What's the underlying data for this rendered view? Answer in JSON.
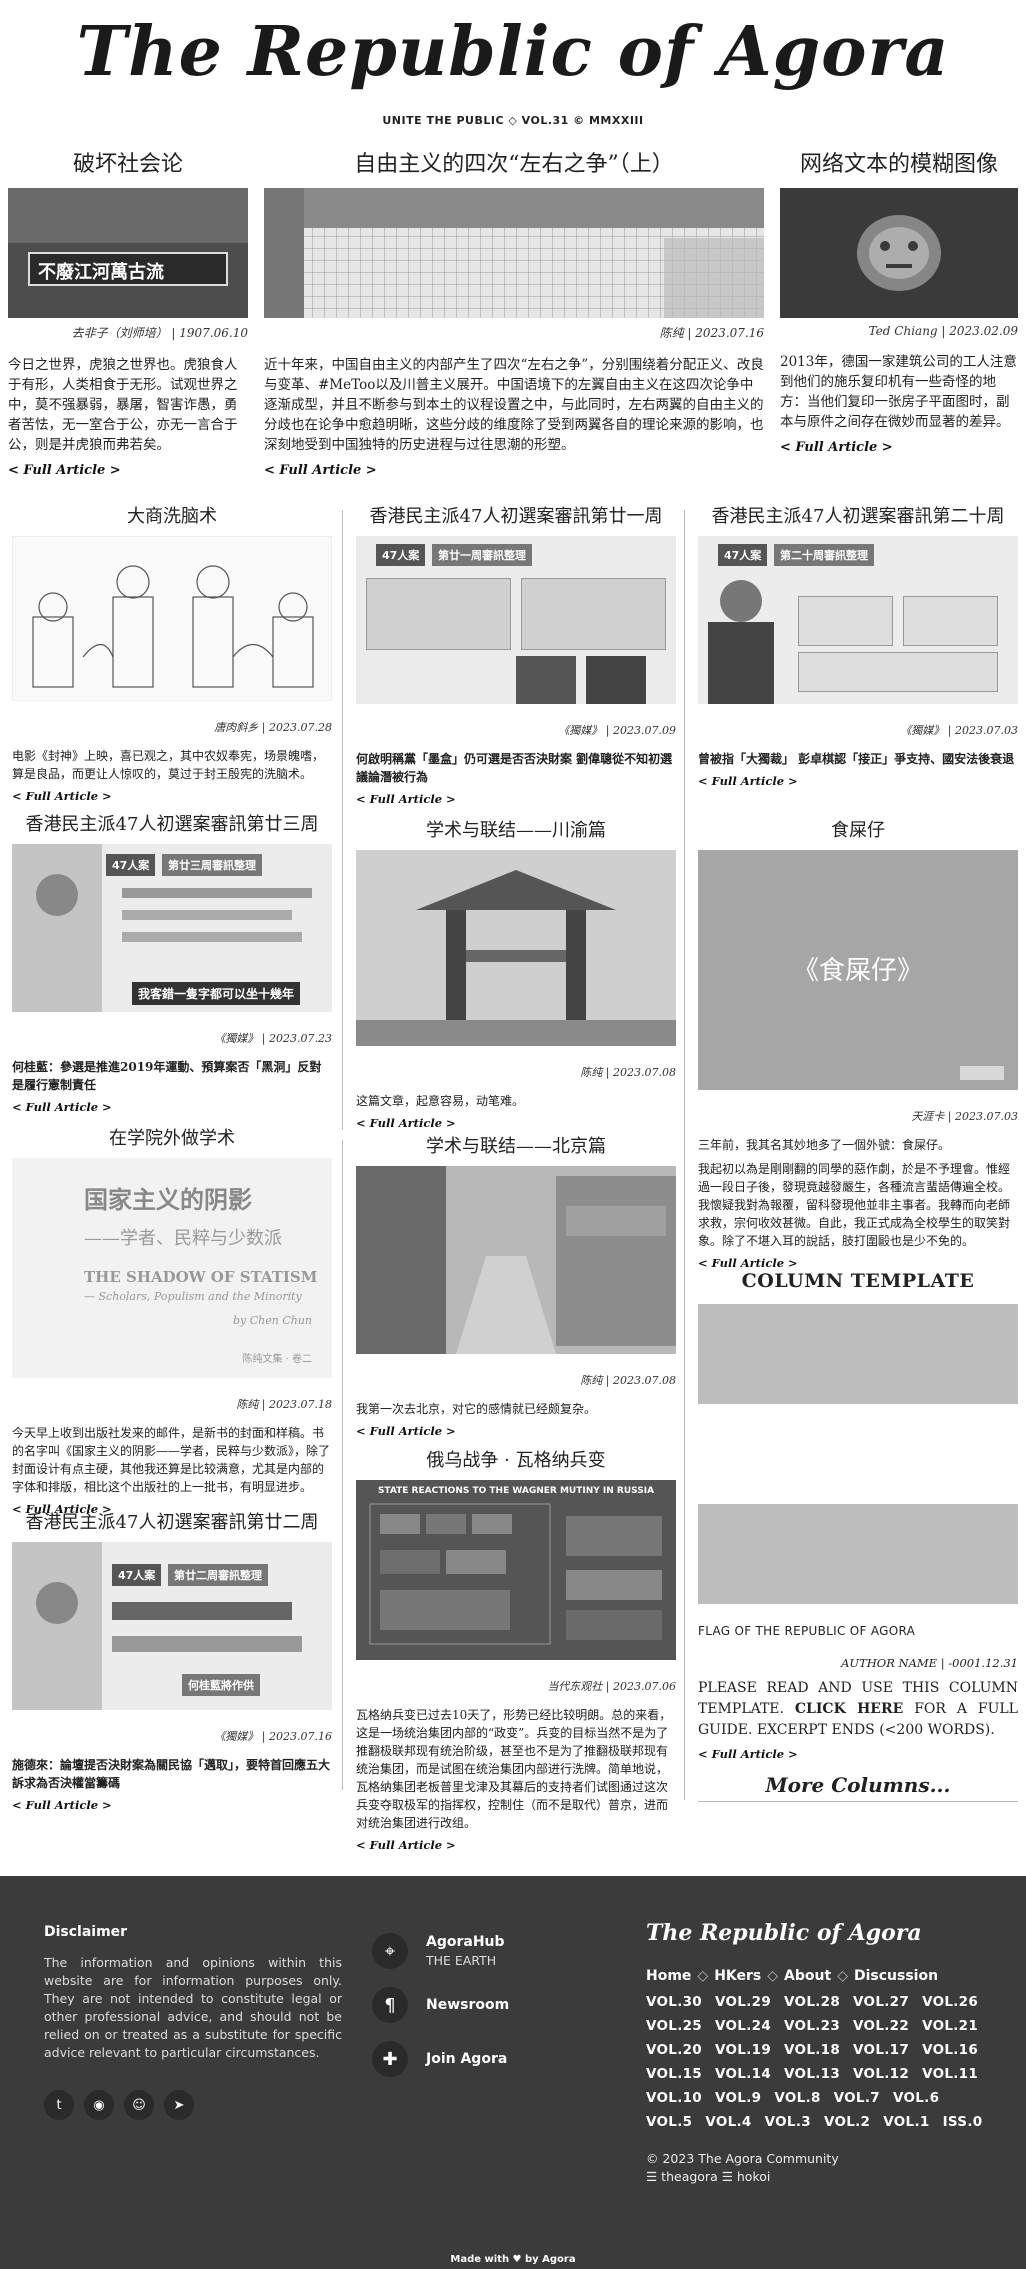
{
  "masthead": {
    "title": "The Republic of Agora",
    "tagline": "UNITE THE PUBLIC ◇ VOL.31 © MMXXIII"
  },
  "top": [
    {
      "title": "破坏社会论",
      "caption": "去非子（刘师培） | 1907.06.10",
      "image_text": "不廢江河萬古流",
      "excerpt": "今日之世界，虎狼之世界也。虎狼食人于有形，人类相食于无形。试观世界之中，莫不强暴弱，暴屠，智害诈愚，勇者苦怯，无一室合于公，亦无一言合于公，则是并虎狼而弗若矣。",
      "link": "< Full Article >"
    },
    {
      "title": "自由主义的四次“左右之争”（上）",
      "caption": "陈纯 | 2023.07.16",
      "excerpt": "近十年来，中国自由主义的内部产生了四次“左右之争”，分别围绕着分配正义、改良与变革、#MeToo以及川普主义展开。中国语境下的左翼自由主义在这四次论争中逐渐成型，并且不断参与到本土的议程设置之中，与此同时，左右两翼的自由主义的分歧也在论争中愈趋明晰，这些分歧的维度除了受到两翼各自的理论来源的影响，也深刻地受到中国独特的历史进程与过往思潮的形塑。",
      "link": "< Full Article >"
    },
    {
      "title": "网络文本的模糊图像",
      "caption": "Ted Chiang | 2023.02.09",
      "excerpt": "2013年，德国一家建筑公司的工人注意到他们的施乐复印机有一些奇怪的地方：当他们复印一张房子平面图时，副本与原件之间存在微妙而显著的差异。",
      "link": "< Full Article >"
    }
  ],
  "col1": [
    {
      "title": "大商洗脑术",
      "caption": "唐肉斜乡 | 2023.07.28",
      "excerpt": "电影《封神》上映，喜已观之，其中农奴奉宪，场景魄嗜，算是良品，而更让人惊叹的，莫过于封王殷宪的洗脑术。",
      "link": "< Full Article >"
    },
    {
      "title": "香港民主派47人初選案審訊第廿三周",
      "caption": "《獨媒》 | 2023.07.23",
      "image_tag": "47人案",
      "image_sub": "第廿三周審訊整理",
      "image_quote": "我客錯一隻字都可以坐十幾年",
      "excerpt": "何桂藍：參選是推進2019年運動、預算案否「黑洞」反對是履行憲制責任",
      "link": "< Full Article >"
    },
    {
      "title": "在学院外做学术",
      "caption": "陈纯 | 2023.07.18",
      "book_title": "国家主义的阴影",
      "book_sub": "——学者、民粹与少数派",
      "book_en": "THE SHADOW OF STATISM",
      "book_en_sub": "— Scholars, Populism and the Minority",
      "book_author": "by Chen Chun",
      "book_series": "陈纯文集 · 卷二",
      "excerpt": "今天早上收到出版社发来的邮件，是新书的封面和样稿。书的名字叫《国家主义的阴影——学者，民粹与少数派》，除了封面设计有点主硬，其他我还算是比较满意，尤其是内部的字体和排版，相比这个出版社的上一批书，有明显进步。",
      "link": "< Full Article >"
    },
    {
      "title": "香港民主派47人初選案審訊第廿二周",
      "caption": "《獨媒》 | 2023.07.16",
      "image_tag": "47人案",
      "image_sub": "第廿二周審訊整理",
      "image_quote": "何桂藍將作供",
      "excerpt": "施德來：論壇提否決財案為關民協「邁取」，要特首回應五大訴求為否決權當籌碼",
      "link": "< Full Article >"
    }
  ],
  "col2": [
    {
      "title": "香港民主派47人初選案審訊第廿一周",
      "caption": "《獨媒》 | 2023.07.09",
      "image_tag": "47人案",
      "image_sub": "第廿一周審訊整理",
      "excerpt": "何啟明稱黨「墨盒」仍可選是否否決財案 劉偉聰從不知初選議論潛被行為",
      "link": "< Full Article >"
    },
    {
      "title": "学术与联结——川渝篇",
      "caption": "陈纯 | 2023.07.08",
      "excerpt": "这篇文章，起意容易，动笔难。",
      "link": "< Full Article >"
    },
    {
      "title": "学术与联结——北京篇",
      "caption": "陈纯 | 2023.07.08",
      "excerpt": "我第一次去北京，对它的感情就已经颇复杂。",
      "link": "< Full Article >"
    },
    {
      "title": "俄乌战争 · 瓦格纳兵变",
      "caption": "当代东观社 | 2023.07.06",
      "chart_heading": "STATE REACTIONS TO THE WAGNER MUTINY IN RUSSIA",
      "excerpt": "瓦格纳兵变已过去10天了，形势已经比较明朗。总的来看，这是一场统治集团内部的“政变”。兵变的目标当然不是为了推翻极联邦现有统治阶级，甚至也不是为了推翻极联邦现有统治集团，而是试图在统治集团内部进行洗牌。简单地说，瓦格纳集团老板普里戈津及其幕后的支持者们试图通过这次兵变夺取极军的指挥权，控制住（而不是取代）普京，进而对统治集团进行改组。",
      "link": "< Full Article >"
    }
  ],
  "col3": [
    {
      "title": "香港民主派47人初選案審訊第二十周",
      "caption": "《獨媒》 | 2023.07.03",
      "image_tag": "47人案",
      "image_sub": "第二十周審訊整理",
      "excerpt": "曾被指「大獨裁」 彭卓棋認「接正」爭支持、國安法後衰退",
      "link": "< Full Article >"
    },
    {
      "title": "食屎仔",
      "caption": "天涯卡 | 2023.07.03",
      "image_text": "《食屎仔》",
      "excerpt1": "三年前，我其名其妙地多了一個外號：食屎仔。",
      "excerpt2": "我起初以為是剛剛翻的同學的惡作劇，於是不予理會。惟經過一段日子後，發現竟越發嚴生，各種流言蜚語傳遍全校。我懷疑我對為報覆，留科發現他並非主事者。我轉而向老師求救，宗何收效甚微。自此，我正式成為全校學生的取笑對象。除了不堪入耳的說話，肢打圍毆也是少不免的。",
      "link": "< Full Article >"
    },
    {
      "template_title": "COLUMN TEMPLATE",
      "flag_caption": "FLAG OF THE REPUBLIC OF AGORA",
      "author": "AUTHOR NAME | -0001.12.31",
      "body_before": "PLEASE READ AND USE THIS COLUMN TEMPLATE.",
      "body_link": "CLICK HERE",
      "body_after": "FOR A FULL GUIDE. EXCERPT ENDS (<200 WORDS).",
      "link": "< Full Article >"
    }
  ],
  "more_columns": "More Columns...",
  "footer": {
    "disclaimer_title": "Disclaimer",
    "disclaimer_text": "The information and opinions within this website are for information purposes only. They are not intended to constitute legal or other professional advice, and should not be relied on or treated as a substitute for specific advice relevant to particular circumstances.",
    "links": [
      {
        "title": "AgoraHub",
        "sub": "THE EARTH",
        "icon": "map-pin-icon"
      },
      {
        "title": "Newsroom",
        "sub": "",
        "icon": "paragraph-icon"
      },
      {
        "title": "Join Agora",
        "sub": "",
        "icon": "puzzle-icon"
      }
    ],
    "logo": "The Republic of Agora",
    "nav": [
      "Home",
      "HKers",
      "About",
      "Discussion"
    ],
    "volumes": [
      "VOL.30",
      "VOL.29",
      "VOL.28",
      "VOL.27",
      "VOL.26",
      "VOL.25",
      "VOL.24",
      "VOL.23",
      "VOL.22",
      "VOL.21",
      "VOL.20",
      "VOL.19",
      "VOL.18",
      "VOL.17",
      "VOL.16",
      "VOL.15",
      "VOL.14",
      "VOL.13",
      "VOL.12",
      "VOL.11",
      "VOL.10",
      "VOL.9",
      "VOL.8",
      "VOL.7",
      "VOL.6",
      "VOL.5",
      "VOL.4",
      "VOL.3",
      "VOL.2",
      "VOL.1",
      "ISS.0"
    ],
    "copyright": "© 2023 The Agora Community",
    "tags": "☰ theagora ☰ hokoi",
    "made_with": "Made with ♥ by Agora"
  }
}
